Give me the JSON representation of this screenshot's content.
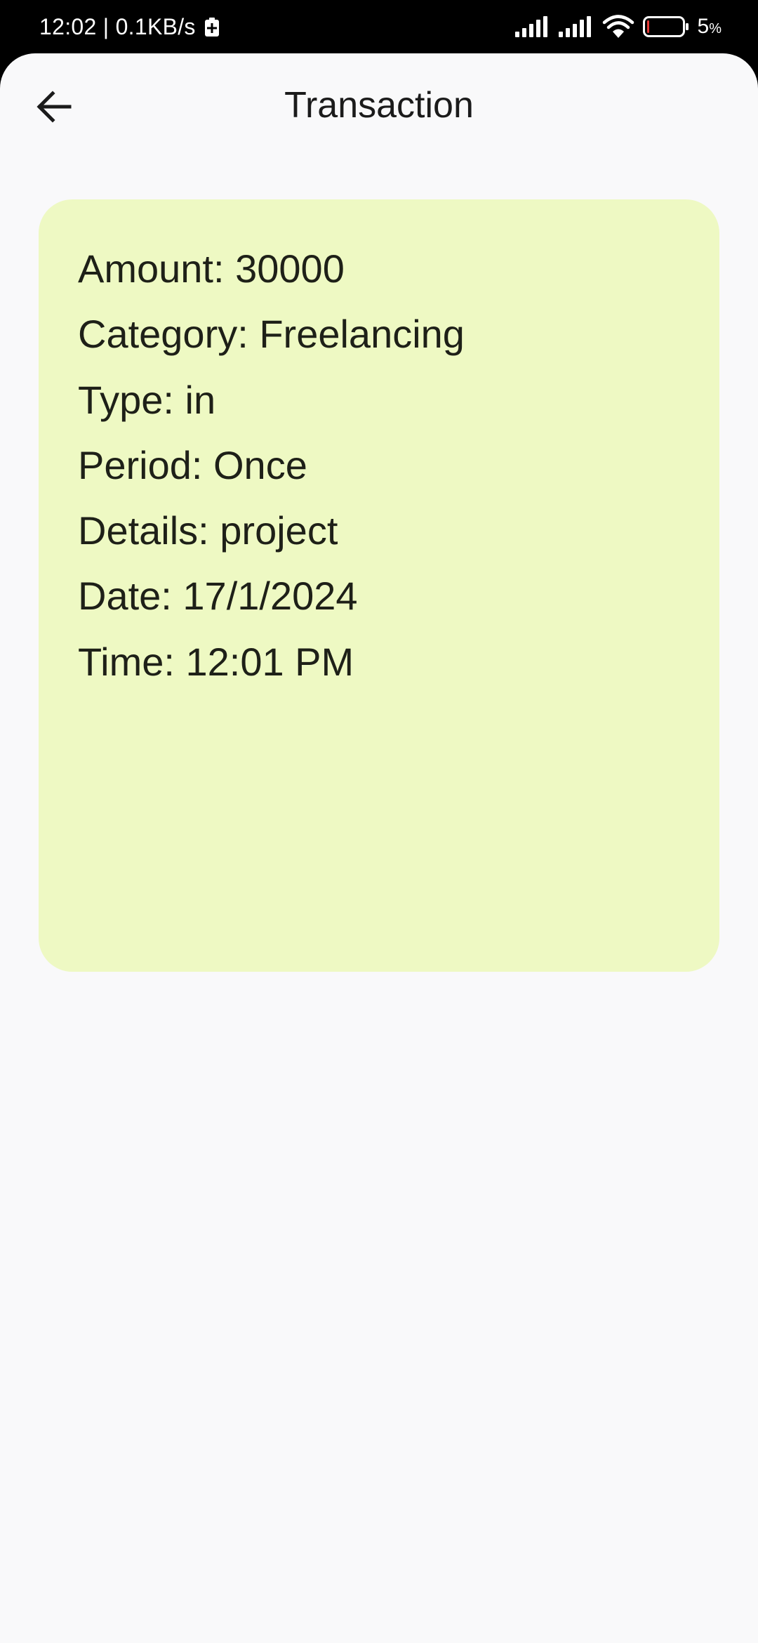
{
  "status_bar": {
    "time_speed": "12:02 | 0.1KB/s",
    "battery_percent": "5",
    "battery_unit": "%",
    "icons": [
      "battery-saver-icon",
      "signal-icon",
      "signal-icon",
      "wifi-icon",
      "battery-icon"
    ],
    "battery_level": 0.05,
    "battery_low_color": "#e53935"
  },
  "app_bar": {
    "title": "Transaction",
    "back_icon": "arrow-left-icon"
  },
  "transaction": {
    "amount": "Amount: 30000",
    "category": "Category: Freelancing",
    "type": "Type: in",
    "period": "Period: Once",
    "details": "Details: project",
    "date": "Date: 17/1/2024",
    "time": "Time: 12:01 PM"
  },
  "colors": {
    "card_background": "#eef9c3",
    "screen_background": "#f9f9fa",
    "text": "#1e2018"
  }
}
